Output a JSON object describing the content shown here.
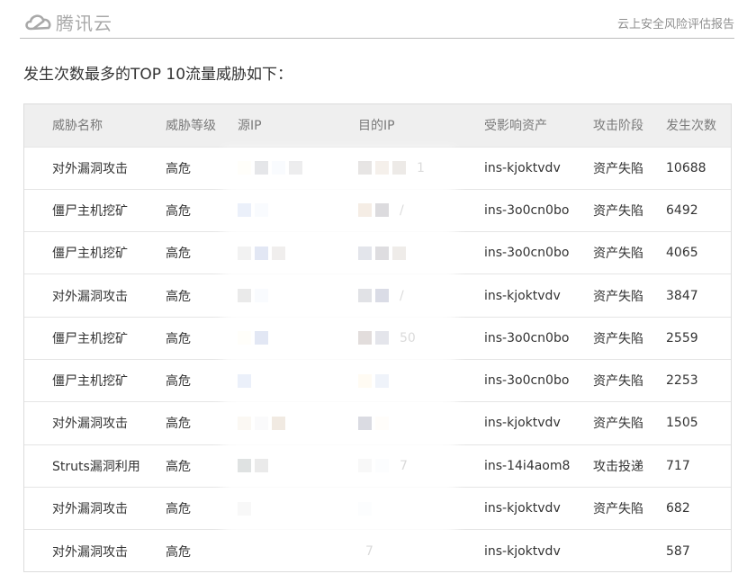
{
  "header": {
    "brand": "腾讯云",
    "report_title": "云上安全风险评估报告"
  },
  "section": {
    "title": "发生次数最多的TOP 10流量威胁如下："
  },
  "table": {
    "columns": [
      "威胁名称",
      "威胁等级",
      "源IP",
      "目的IP",
      "受影响资产",
      "攻击阶段",
      "发生次数"
    ],
    "rows": [
      {
        "name": "对外漏洞攻击",
        "level": "高危",
        "src": "",
        "dst": "1",
        "asset": "ins-kjoktvdv",
        "stage": "资产失陷",
        "count": "10688"
      },
      {
        "name": "僵尸主机挖矿",
        "level": "高危",
        "src": "",
        "dst": "/",
        "asset": "ins-3o0cn0bo",
        "stage": "资产失陷",
        "count": "6492"
      },
      {
        "name": "僵尸主机挖矿",
        "level": "高危",
        "src": "",
        "dst": "",
        "asset": "ins-3o0cn0bo",
        "stage": "资产失陷",
        "count": "4065"
      },
      {
        "name": "对外漏洞攻击",
        "level": "高危",
        "src": "",
        "dst": "/",
        "asset": "ins-kjoktvdv",
        "stage": "资产失陷",
        "count": "3847"
      },
      {
        "name": "僵尸主机挖矿",
        "level": "高危",
        "src": "",
        "dst": "50",
        "asset": "ins-3o0cn0bo",
        "stage": "资产失陷",
        "count": "2559"
      },
      {
        "name": "僵尸主机挖矿",
        "level": "高危",
        "src": "",
        "dst": "",
        "asset": "ins-3o0cn0bo",
        "stage": "资产失陷",
        "count": "2253"
      },
      {
        "name": "对外漏洞攻击",
        "level": "高危",
        "src": "",
        "dst": "",
        "asset": "ins-kjoktvdv",
        "stage": "资产失陷",
        "count": "1505"
      },
      {
        "name": "Struts漏洞利用",
        "level": "高危",
        "src": "",
        "dst": "7",
        "asset": "ins-14i4aom8",
        "stage": "攻击投递",
        "count": "717"
      },
      {
        "name": "对外漏洞攻击",
        "level": "高危",
        "src": "",
        "dst": "",
        "asset": "ins-kjoktvdv",
        "stage": "资产失陷",
        "count": "682"
      },
      {
        "name": "对外漏洞攻击",
        "level": "高危",
        "src": "",
        "dst": "7",
        "asset": "ins-kjoktvdv",
        "stage": "",
        "count": "587"
      }
    ]
  },
  "colors": {
    "brand_gray": "#a8a8a8",
    "header_bg": "#efefef",
    "redaction_tiles": [
      "#fdf6e0",
      "#6f7583",
      "#dfeaf7",
      "#9a9a9e",
      "#7a6e68",
      "#c8aa90",
      "#9c8b7c",
      "#8faee0",
      "#c89a70",
      "#3e3a48",
      "#b8b8b8",
      "#5d7cc0",
      "#aaa29b",
      "#647090",
      "#4a4555",
      "#a69686",
      "#8a8a8a",
      "#5c6276",
      "#343f73",
      "#5d4540",
      "#6a7290",
      "#fbe8bb",
      "#a5bde0",
      "#ead9bc",
      "#e0e0e8",
      "#b08a60",
      "#343b5f",
      "#fbf5e1",
      "#506060",
      "#d9d7d6",
      "#eef0f9"
    ]
  }
}
